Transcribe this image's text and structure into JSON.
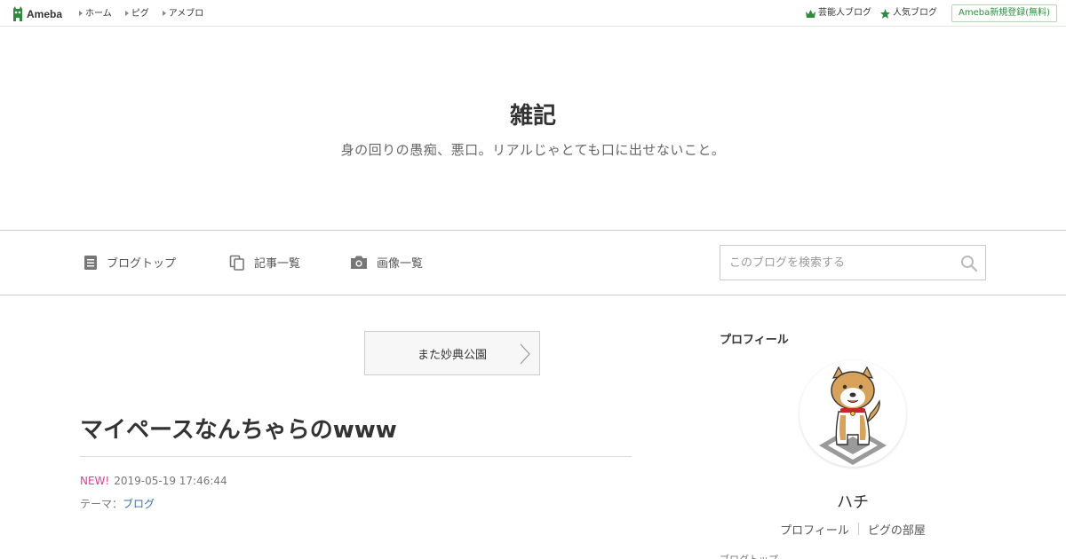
{
  "topbar": {
    "logo_text": "Ameba",
    "nav": [
      "ホーム",
      "ピグ",
      "アメブロ"
    ],
    "celebrity_blog": "芸能人ブログ",
    "popular_blog": "人気ブログ",
    "register_button": "Ameba新規登録(無料)",
    "colors": {
      "brand_green": "#2d8c3c"
    }
  },
  "header": {
    "title": "雑記",
    "description": "身の回りの愚痴、悪口。リアルじゃとても口に出せないこと。"
  },
  "navbar": {
    "blog_top": "ブログトップ",
    "entry_list": "記事一覧",
    "image_list": "画像一覧",
    "search_placeholder": "このブログを検索する"
  },
  "entry": {
    "next_entry_label": "また妙典公園",
    "title": "マイペースなんちゃらのwww",
    "new_badge": "NEW!",
    "datetime": "2019-05-19 17:46:44",
    "theme_prefix": "テーマ：",
    "theme": "ブログ"
  },
  "sidebar": {
    "heading": "プロフィール",
    "name": "ハチ",
    "profile_link": "プロフィール",
    "pigg_link": "ピグの部屋",
    "more_text": "ブログトップ"
  }
}
